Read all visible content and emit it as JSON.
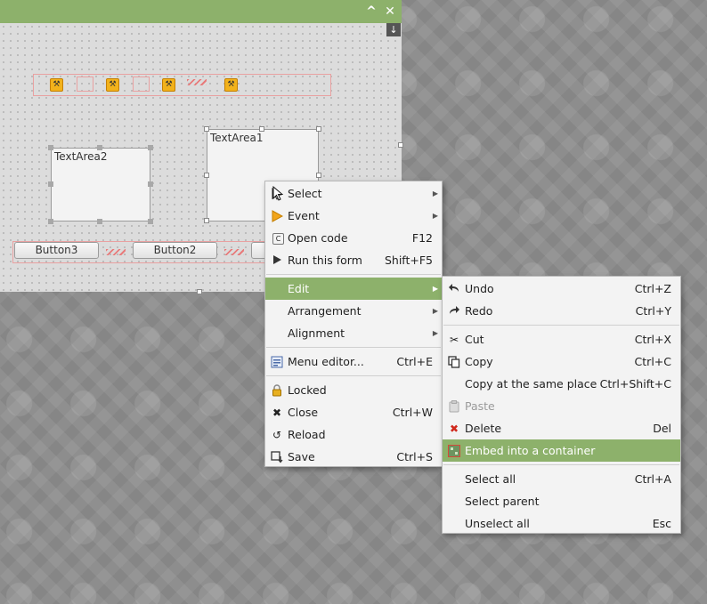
{
  "window": {
    "maximize_glyph": "^",
    "close_glyph": "✕",
    "scroll_glyph": "↓"
  },
  "form": {
    "textarea2": "TextArea2",
    "textarea1": "TextArea1",
    "button3": "Button3",
    "button2": "Button2"
  },
  "context_menu": {
    "items": [
      {
        "label": "Select",
        "shortcut": "",
        "icon": "cursor-icon",
        "submenu": true
      },
      {
        "label": "Event",
        "shortcut": "",
        "icon": "event-icon",
        "submenu": true
      },
      {
        "label": "Open code",
        "shortcut": "F12",
        "icon": "code-icon",
        "submenu": false
      },
      {
        "label": "Run this form",
        "shortcut": "Shift+F5",
        "icon": "run-icon",
        "submenu": false
      },
      {
        "label": "Edit",
        "shortcut": "",
        "icon": "",
        "submenu": true,
        "highlighted": true
      },
      {
        "label": "Arrangement",
        "shortcut": "",
        "icon": "",
        "submenu": true
      },
      {
        "label": "Alignment",
        "shortcut": "",
        "icon": "",
        "submenu": true
      },
      {
        "label": "Menu editor...",
        "shortcut": "Ctrl+E",
        "icon": "menu-editor-icon",
        "submenu": false
      },
      {
        "label": "Locked",
        "shortcut": "",
        "icon": "lock-icon",
        "submenu": false
      },
      {
        "label": "Close",
        "shortcut": "Ctrl+W",
        "icon": "close-icon",
        "submenu": false
      },
      {
        "label": "Reload",
        "shortcut": "",
        "icon": "reload-icon",
        "submenu": false
      },
      {
        "label": "Save",
        "shortcut": "Ctrl+S",
        "icon": "save-icon",
        "submenu": false
      }
    ]
  },
  "edit_submenu": {
    "items": [
      {
        "label": "Undo",
        "shortcut": "Ctrl+Z",
        "icon": "undo-icon"
      },
      {
        "label": "Redo",
        "shortcut": "Ctrl+Y",
        "icon": "redo-icon"
      },
      {
        "label": "Cut",
        "shortcut": "Ctrl+X",
        "icon": "cut-icon"
      },
      {
        "label": "Copy",
        "shortcut": "Ctrl+C",
        "icon": "copy-icon"
      },
      {
        "label": "Copy at the same place",
        "shortcut": "Ctrl+Shift+C",
        "icon": ""
      },
      {
        "label": "Paste",
        "shortcut": "",
        "icon": "paste-icon",
        "disabled": true
      },
      {
        "label": "Delete",
        "shortcut": "Del",
        "icon": "delete-icon"
      },
      {
        "label": "Embed into a container",
        "shortcut": "",
        "icon": "embed-icon",
        "highlighted": true
      },
      {
        "label": "Select all",
        "shortcut": "Ctrl+A",
        "icon": ""
      },
      {
        "label": "Select parent",
        "shortcut": "",
        "icon": ""
      },
      {
        "label": "Unselect all",
        "shortcut": "Esc",
        "icon": ""
      }
    ]
  },
  "colors": {
    "accent": "#8db16b",
    "delete_icon": "#d0281c",
    "tool_icon": "#f2b21b"
  }
}
